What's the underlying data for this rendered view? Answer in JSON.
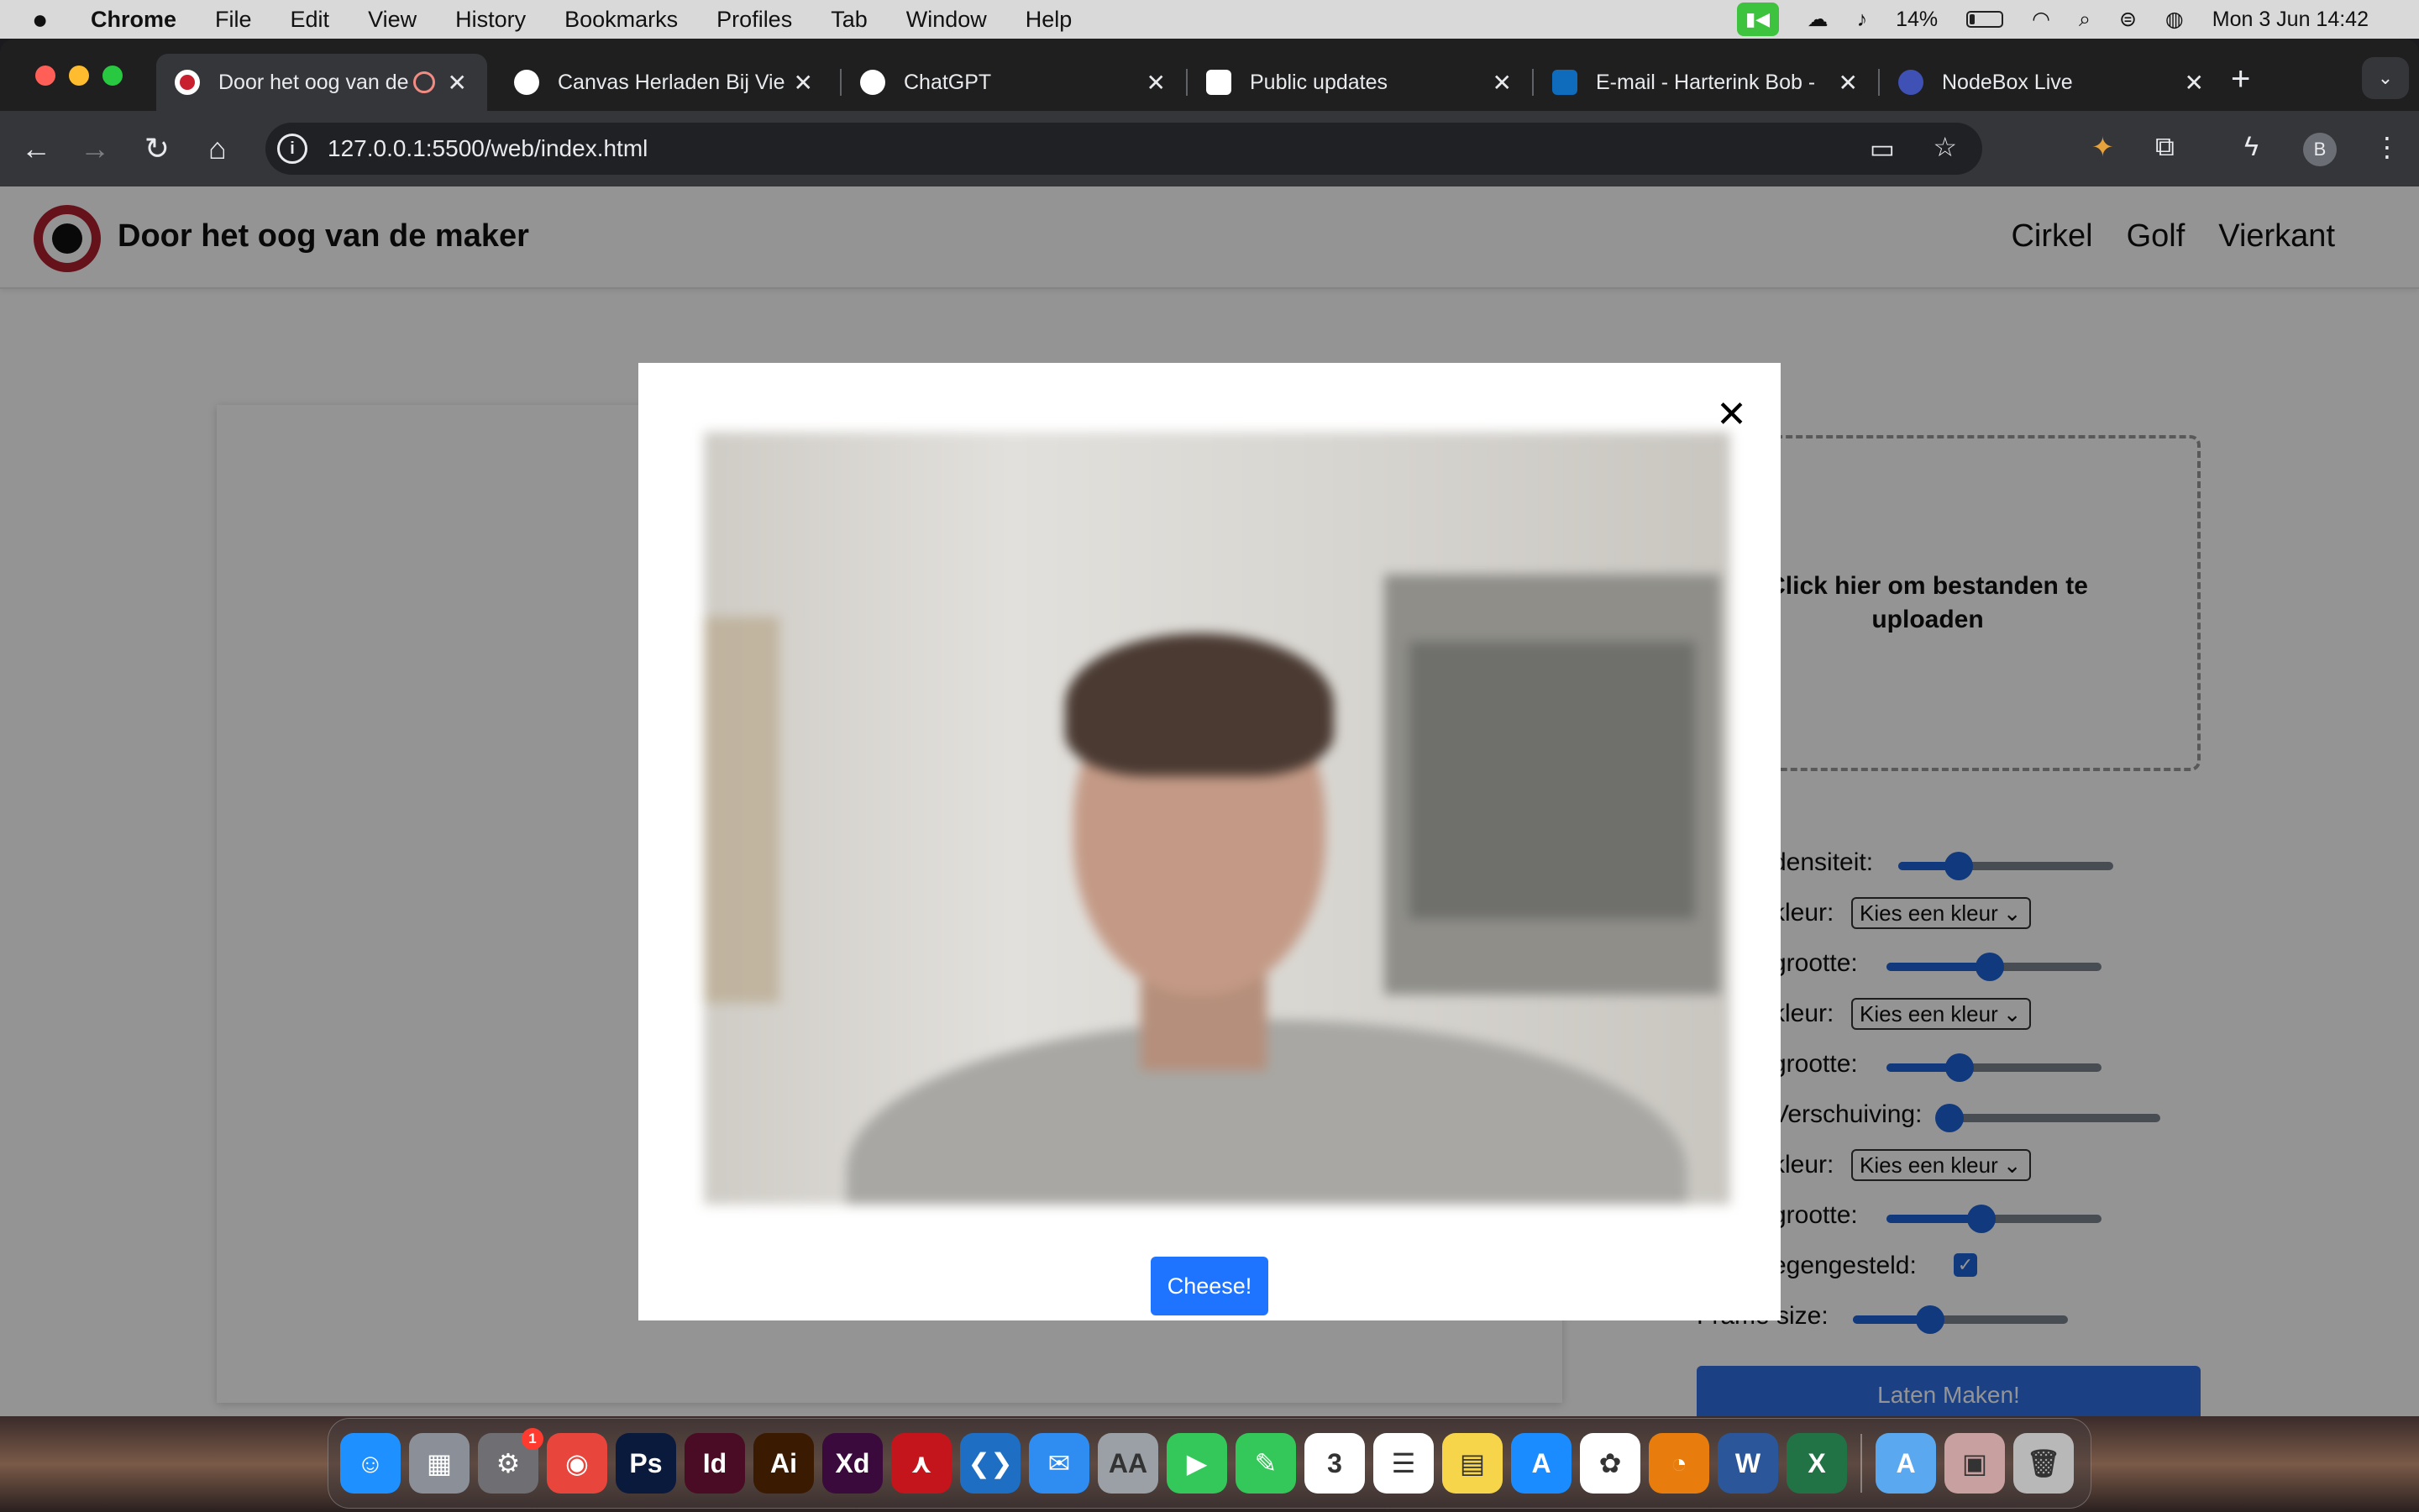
{
  "menubar": {
    "app": "Chrome",
    "items": [
      "File",
      "Edit",
      "View",
      "History",
      "Bookmarks",
      "Profiles",
      "Tab",
      "Window",
      "Help"
    ],
    "battery": "14%",
    "datetime": "Mon 3 Jun  14:42"
  },
  "tabs": [
    {
      "title": "Door het oog van de",
      "active": true,
      "favicon_color": "#c8202f"
    },
    {
      "title": "Canvas Herladen Bij Vie",
      "active": false,
      "favicon_color": "#ffffff"
    },
    {
      "title": "ChatGPT",
      "active": false,
      "favicon_color": "#ffffff"
    },
    {
      "title": "Public updates",
      "active": false,
      "favicon_color": "#ffffff"
    },
    {
      "title": "E-mail - Harterink Bob -",
      "active": false,
      "favicon_color": "#0f6cbd"
    },
    {
      "title": "NodeBox Live",
      "active": false,
      "favicon_color": "#3f51b5"
    }
  ],
  "address_bar": {
    "url": "127.0.0.1:5500/web/index.html",
    "profile_initial": "B"
  },
  "site": {
    "brand": "Door het oog van de maker",
    "nav": [
      "Cirkel",
      "Golf",
      "Vierkant"
    ]
  },
  "upload": {
    "label": "Click hier om bestanden te uploaden"
  },
  "controls": [
    {
      "label": "densiteit:",
      "type": "slider",
      "value": 0.28
    },
    {
      "label": "kleur:",
      "type": "select",
      "selected": "Kies een kleur"
    },
    {
      "label": "grootte:",
      "type": "slider",
      "value": 0.48
    },
    {
      "label": "kleur:",
      "type": "select",
      "selected": "Kies een kleur"
    },
    {
      "label": "grootte:",
      "type": "slider",
      "value": 0.34
    },
    {
      "label": "Verschuiving:",
      "type": "slider",
      "value": 0.02
    },
    {
      "label": "kleur:",
      "type": "select",
      "selected": "Kies een kleur"
    },
    {
      "label": "grootte:",
      "type": "slider",
      "value": 0.44
    },
    {
      "label": "egengesteld:",
      "type": "checkbox",
      "checked": true
    },
    {
      "label": "Frame size:",
      "type": "slider",
      "value": 0.36
    }
  ],
  "make_button": "Laten Maken!",
  "modal": {
    "close": "✕",
    "capture_button": "Cheese!"
  },
  "dock": {
    "apps": [
      {
        "name": "finder-icon",
        "glyph": "☺",
        "color": "#1e90ff"
      },
      {
        "name": "launchpad-icon",
        "glyph": "▦",
        "color": "#8a8f98"
      },
      {
        "name": "system-settings-icon",
        "glyph": "⚙",
        "color": "#6e6e73",
        "badge": "1"
      },
      {
        "name": "chrome-icon",
        "glyph": "◉",
        "color": "#e8453c"
      },
      {
        "name": "photoshop-icon",
        "glyph": "Ps",
        "color": "#0a1a3d"
      },
      {
        "name": "indesign-icon",
        "glyph": "Id",
        "color": "#4a0b24"
      },
      {
        "name": "illustrator-icon",
        "glyph": "Ai",
        "color": "#3a1a00"
      },
      {
        "name": "xd-icon",
        "glyph": "Xd",
        "color": "#3a0a3d"
      },
      {
        "name": "acrobat-icon",
        "glyph": "⋏",
        "color": "#c4151c"
      },
      {
        "name": "vscode-icon",
        "glyph": "❮❯",
        "color": "#1e6fc4"
      },
      {
        "name": "mail-icon",
        "glyph": "✉",
        "color": "#2f8cf0"
      },
      {
        "name": "font-book-icon",
        "glyph": "AA",
        "color": "#9aa0a6"
      },
      {
        "name": "facetime-icon",
        "glyph": "▶",
        "color": "#34c759"
      },
      {
        "name": "messages-icon",
        "glyph": "✎",
        "color": "#34c759"
      },
      {
        "name": "calendar-icon",
        "glyph": "3",
        "color": "#ffffff"
      },
      {
        "name": "reminders-icon",
        "glyph": "☰",
        "color": "#ffffff"
      },
      {
        "name": "notes-icon",
        "glyph": "▤",
        "color": "#f7d54a"
      },
      {
        "name": "app-store-icon",
        "glyph": "A",
        "color": "#1a8cff"
      },
      {
        "name": "photos-icon",
        "glyph": "✿",
        "color": "#ffffff"
      },
      {
        "name": "blender-icon",
        "glyph": "◔",
        "color": "#e87d0d"
      },
      {
        "name": "word-icon",
        "glyph": "W",
        "color": "#2b579a"
      },
      {
        "name": "excel-icon",
        "glyph": "X",
        "color": "#217346"
      }
    ],
    "pinned": [
      {
        "name": "downloads-folder-icon",
        "glyph": "A",
        "color": "#5aa9f0"
      },
      {
        "name": "recent-file-icon",
        "glyph": "▣",
        "color": "#c9a0a0"
      },
      {
        "name": "trash-icon",
        "glyph": "🗑",
        "color": "#b8b8b8"
      }
    ]
  }
}
